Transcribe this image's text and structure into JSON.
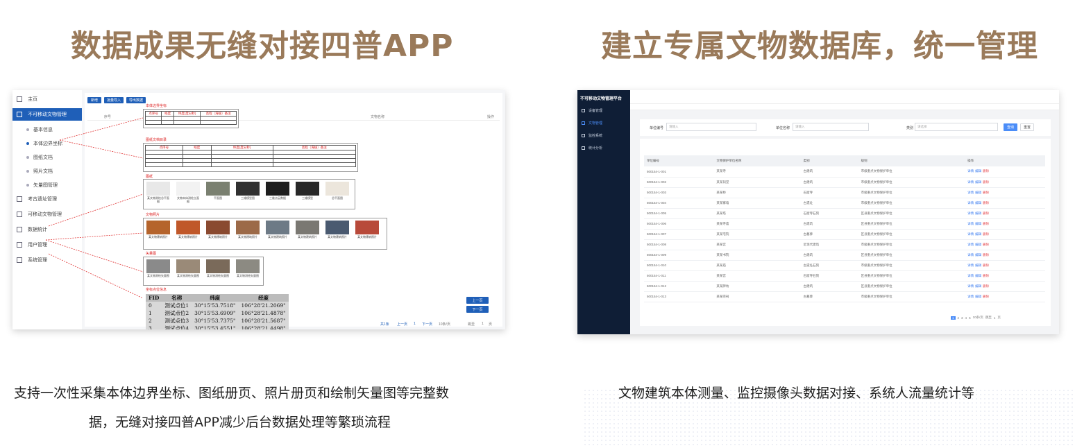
{
  "headings": {
    "left": "数据成果无缝对接四普APP",
    "right": "建立专属文物数据库，统一管理"
  },
  "captions": {
    "left_line1": "支持一次性采集本体边界坐标、图纸册页、照片册页和绘制矢量图等完整数",
    "left_line2": "据，无缝对接四普APP减少后台数据处理等繁琐流程",
    "right_line1": "文物建筑本体测量、监控摄像头数据对接、系统人流量统计等"
  },
  "left_app": {
    "sidebar": [
      {
        "label": "主页",
        "level": 0,
        "active": false
      },
      {
        "label": "不可移动文物管理",
        "level": 0,
        "active": true
      },
      {
        "label": "基本信息",
        "level": 1,
        "active": false
      },
      {
        "label": "本体边界坐标",
        "level": 1,
        "active": false,
        "current": true
      },
      {
        "label": "图纸文档",
        "level": 1,
        "active": false
      },
      {
        "label": "照片文档",
        "level": 1,
        "active": false
      },
      {
        "label": "矢量图管理",
        "level": 1,
        "active": false
      },
      {
        "label": "考古遗址管理",
        "level": 0,
        "active": false
      },
      {
        "label": "可移动文物管理",
        "level": 0,
        "active": false
      },
      {
        "label": "数据统计",
        "level": 0,
        "active": false
      },
      {
        "label": "用户管理",
        "level": 0,
        "active": false
      },
      {
        "label": "系统管理",
        "level": 0,
        "active": false
      }
    ],
    "toolbar": [
      "新增",
      "批量导入",
      "导出数据"
    ],
    "table_headers": [
      "序号",
      "文物名称",
      "操作"
    ],
    "overlay1_title": "本体边界坐标",
    "overlay1_headers": [
      "点序号",
      "经度",
      "纬度(度分秒)",
      "高程（海拔）备注"
    ],
    "overlay2_title": "图纸文档目录",
    "overlay2_headers": [
      "点序号",
      "经度",
      "纬度(度分秒)",
      "高程（海拔）备注"
    ],
    "drawings_title": "图纸",
    "drawings": [
      "某文物测绘总平面图",
      "文物本体测绘立面图",
      "平面图",
      "三维模型图",
      "三维点云数据",
      "三维模型",
      "总平面图"
    ],
    "photos_title": "文物照片",
    "photos": [
      "某文物建筑照片",
      "某文物建筑照片",
      "某文物建筑照片",
      "某文物建筑照片",
      "某文物建筑照片",
      "某文物建筑照片",
      "某文物建筑照片",
      "某文物建筑照片"
    ],
    "vector_title": "矢量图",
    "vectors": [
      "某文物测绘矢量图",
      "某文物测绘矢量图",
      "某文物测绘矢量图",
      "某文物测绘矢量图"
    ],
    "coord_title": "坐标点位信息",
    "coord_headers": [
      "FID",
      "名称",
      "纬度",
      "经度"
    ],
    "coord_rows": [
      [
        "0",
        "测试点位1",
        "30°15'53.7518\"",
        "106°28'21.2069\""
      ],
      [
        "1",
        "测试点位2",
        "30°15'53.6909\"",
        "106°28'21.4878\""
      ],
      [
        "2",
        "测试点位3",
        "30°15'53.7375\"",
        "106°28'21.5687\""
      ],
      [
        "3",
        "测试点位4",
        "30°15'53.4551\"",
        "106°28'21.4498\""
      ]
    ],
    "right_buttons": [
      "上一页",
      "下一页"
    ],
    "pager": [
      "共1条",
      "上一页",
      "1",
      "下一页",
      "10条/页",
      "跳至",
      "1",
      "页"
    ]
  },
  "right_app": {
    "brand": "不可移动文物管理平台",
    "nav": [
      {
        "label": "设备管理",
        "active": false
      },
      {
        "label": "文物管理",
        "active": true
      },
      {
        "label": "监控系统",
        "active": false
      },
      {
        "label": "统计分析",
        "active": false
      }
    ],
    "search": [
      {
        "label": "单位编号",
        "placeholder": "请输入"
      },
      {
        "label": "单位名称",
        "placeholder": "请输入"
      },
      {
        "label": "类别",
        "placeholder": "请选择"
      }
    ],
    "btn_search": "查询",
    "btn_reset": "重置",
    "table_headers": [
      "单位编号",
      "文物保护单位名称",
      "类别",
      "级别",
      "操作"
    ],
    "rows": [
      [
        "500154-1-001",
        "某某寺",
        "古建筑",
        "市级重点文物保护单位"
      ],
      [
        "500154-1-002",
        "某某祠堂",
        "古建筑",
        "市级重点文物保护单位"
      ],
      [
        "500154-1-003",
        "某某桥",
        "石窟寺",
        "市级重点文物保护单位"
      ],
      [
        "500154-1-004",
        "某某寨墙",
        "古遗址",
        "市级重点文物保护单位"
      ],
      [
        "500154-1-005",
        "某某塔",
        "石窟寺石刻",
        "区县重点文物保护单位"
      ],
      [
        "500154-1-006",
        "某某寺庙",
        "古建筑",
        "区县重点文物保护单位"
      ],
      [
        "500154-1-007",
        "某某宅院",
        "古墓葬",
        "区县重点文物保护单位"
      ],
      [
        "500154-1-008",
        "某某宫",
        "近现代建筑",
        "市级重点文物保护单位"
      ],
      [
        "500154-1-009",
        "某某书院",
        "古建筑",
        "区县重点文物保护单位"
      ],
      [
        "500154-1-010",
        "某某庙",
        "古遗址石刻",
        "市级重点文物保护单位"
      ],
      [
        "500154-1-011",
        "某某宫",
        "石窟寺石刻",
        "区县重点文物保护单位"
      ],
      [
        "500154-1-012",
        "某某牌坊",
        "古建筑",
        "区县重点文物保护单位"
      ],
      [
        "500154-1-013",
        "某某宗祠",
        "古墓葬",
        "市级重点文物保护单位"
      ]
    ],
    "row_ops": [
      "详情",
      "编辑",
      "删除"
    ],
    "pager": [
      "1",
      "2",
      "3",
      "4",
      "5",
      "10条/页",
      "跳至",
      "1",
      "页"
    ]
  }
}
